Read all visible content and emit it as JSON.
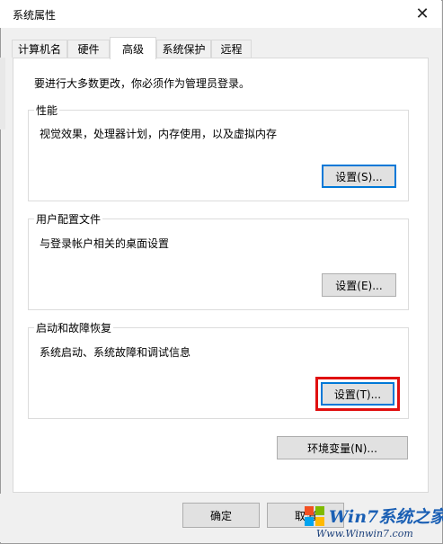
{
  "window": {
    "title": "系统属性",
    "close_glyph": "✕"
  },
  "tabs": [
    {
      "label": "计算机名",
      "active": false
    },
    {
      "label": "硬件",
      "active": false
    },
    {
      "label": "高级",
      "active": true
    },
    {
      "label": "系统保护",
      "active": false
    },
    {
      "label": "远程",
      "active": false
    }
  ],
  "notice": "要进行大多数更改，你必须作为管理员登录。",
  "groups": {
    "performance": {
      "label": "性能",
      "description": "视觉效果，处理器计划，内存使用，以及虚拟内存",
      "button": "设置(S)..."
    },
    "profile": {
      "label": "用户配置文件",
      "description": "与登录帐户相关的桌面设置",
      "button": "设置(E)..."
    },
    "startup": {
      "label": "启动和故障恢复",
      "description": "系统启动、系统故障和调试信息",
      "button": "设置(T)..."
    }
  },
  "env_button": "环境变量(N)...",
  "footer": {
    "ok": "确定",
    "cancel_partial": "取消"
  },
  "watermark": {
    "brand": "Win7系统之家",
    "url": "Www.Winwin7.com"
  },
  "colors": {
    "highlight": "#e01010",
    "focus": "#0078d7"
  }
}
